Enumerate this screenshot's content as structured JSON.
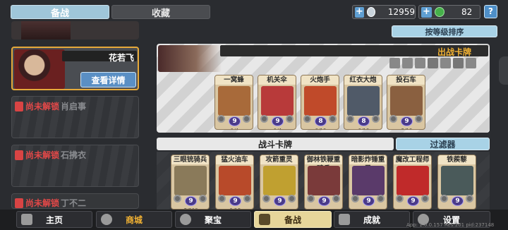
{
  "tabs": {
    "deploy": "备战",
    "collection": "收藏"
  },
  "resources": {
    "coins": "12959",
    "gems": "82",
    "help": "?"
  },
  "sort_button": "按等级排序",
  "heroes": [
    {
      "name": "花若飞",
      "detail_button": "查看详情"
    },
    {
      "locked_label": "尚未解锁",
      "ghost_name": "肖启事"
    },
    {
      "locked_label": "尚未解锁",
      "ghost_name": "石拂衣"
    },
    {
      "locked_label": "尚未解锁",
      "ghost_name": "丁不二"
    }
  ],
  "battle_cards_title": "出战卡牌",
  "battle_cards": [
    {
      "name": "一窝蜂",
      "cost": "9",
      "count": "1/4",
      "art": "#a86a3a"
    },
    {
      "name": "机关伞",
      "cost": "9",
      "count": "1/4",
      "art": "#b83a3a"
    },
    {
      "name": "火炮手",
      "cost": "8",
      "count": "0/10",
      "art": "#c04a2a"
    },
    {
      "name": "红衣大炮",
      "cost": "8",
      "count": "0/10",
      "art": "#505a68"
    },
    {
      "name": "投石车",
      "cost": "9",
      "count": "2/10",
      "art": "#8a6040"
    }
  ],
  "deck_title": "战斗卡牌",
  "filter_button": "过滤器",
  "deck_cards": [
    {
      "name": "三眼铳骑兵",
      "cost": "9",
      "count": "7/200",
      "art": "#8a7a5a"
    },
    {
      "name": "猛火油车",
      "cost": "9",
      "count": "5/15",
      "art": "#b84a2a"
    },
    {
      "name": "攻箭重灵",
      "cost": "9",
      "count": "",
      "art": "#c0a030"
    },
    {
      "name": "御林铁鞭重骑兵",
      "cost": "9",
      "count": "",
      "art": "#7a3a3a"
    },
    {
      "name": "暗影炸锤重灵",
      "cost": "9",
      "count": "",
      "art": "#5a3a6a"
    },
    {
      "name": "魔改工程师",
      "cost": "9",
      "count": "",
      "art": "#c02a2a"
    },
    {
      "name": "铁蒺藜",
      "cost": "9",
      "count": "",
      "art": "#4a5a5a"
    }
  ],
  "nav": [
    "主页",
    "商城",
    "聚宝",
    "备战",
    "成就",
    "设置"
  ],
  "version": "App: 1.0.0.157 Res:201 pid:237148"
}
